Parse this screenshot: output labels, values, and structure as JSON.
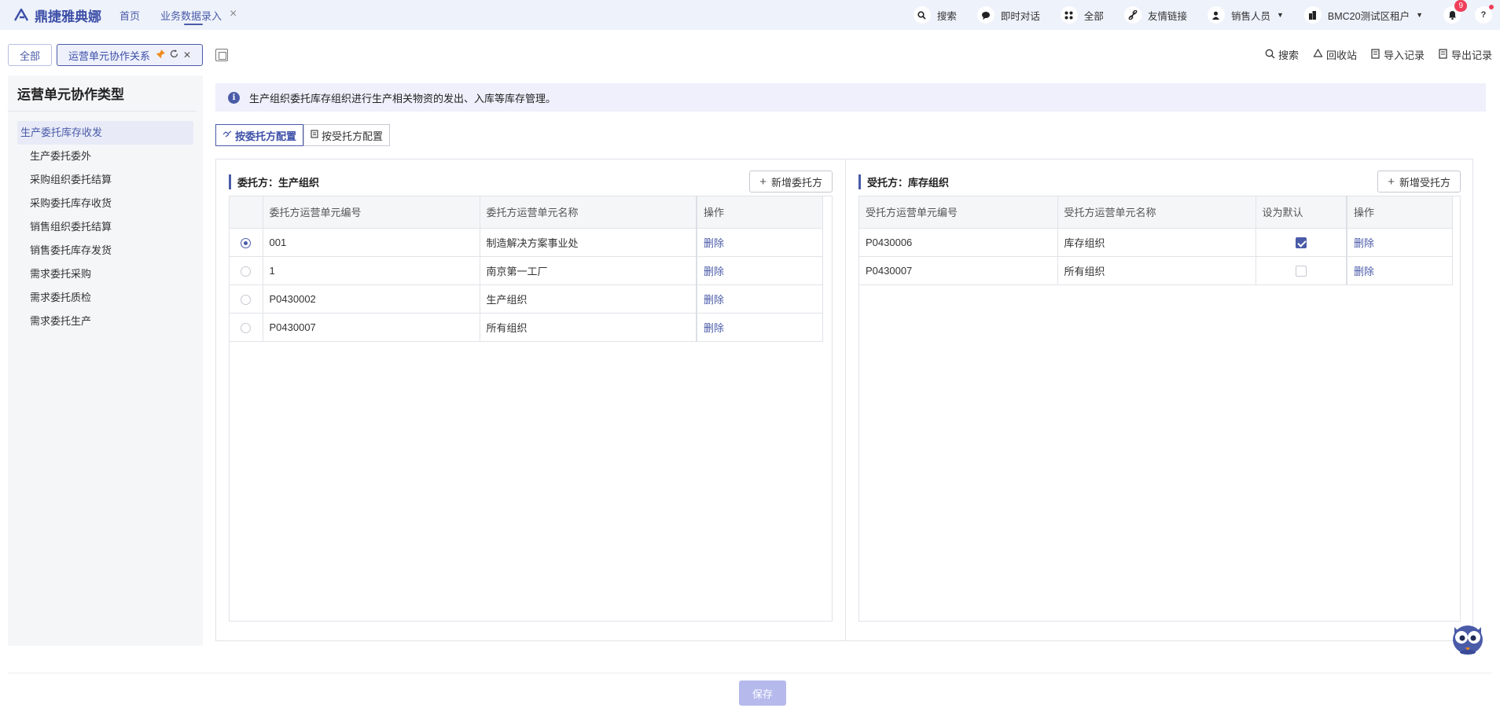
{
  "topbar": {
    "logo_text": "鼎捷雅典娜",
    "nav": [
      {
        "label": "首页"
      },
      {
        "label": "业务数据录入"
      }
    ],
    "close_glyph": "×",
    "right_items": [
      {
        "label": "搜索",
        "icon": "search-icon"
      },
      {
        "label": "即时对话",
        "icon": "chat-icon"
      },
      {
        "label": "全部",
        "icon": "grid-icon"
      },
      {
        "label": "友情链接",
        "icon": "link-icon"
      },
      {
        "label": "销售人员",
        "icon": "user-icon"
      },
      {
        "label": "BMC20测试区租户",
        "icon": "building-icon"
      }
    ],
    "notification_count": "9"
  },
  "tabs": {
    "all_label": "全部",
    "active_label": "运营单元协作关系"
  },
  "right_links": [
    {
      "label": "搜索",
      "icon": "search-icon"
    },
    {
      "label": "回收站",
      "icon": "recycle-icon"
    },
    {
      "label": "导入记录",
      "icon": "import-icon"
    },
    {
      "label": "导出记录",
      "icon": "export-icon"
    }
  ],
  "sidebar": {
    "title": "运营单元协作类型",
    "items": [
      {
        "label": "生产委托库存收发",
        "active": true
      },
      {
        "label": "生产委托委外"
      },
      {
        "label": "采购组织委托结算"
      },
      {
        "label": "采购委托库存收货"
      },
      {
        "label": "销售组织委托结算"
      },
      {
        "label": "销售委托库存发货"
      },
      {
        "label": "需求委托采购"
      },
      {
        "label": "需求委托质检"
      },
      {
        "label": "需求委托生产"
      }
    ]
  },
  "info": {
    "icon_glyph": "i",
    "text": "生产组织委托库存组织进行生产相关物资的发出、入库等库存管理。"
  },
  "toggle": {
    "by_delegator": "按委托方配置",
    "by_delegatee": "按受托方配置"
  },
  "left_panel": {
    "title": "委托方：生产组织",
    "add_label": "新增委托方",
    "columns": [
      "委托方运营单元编号",
      "委托方运营单元名称",
      "操作"
    ],
    "rows": [
      {
        "code": "001",
        "name": "制造解决方案事业处",
        "op": "删除",
        "selected": true
      },
      {
        "code": "1",
        "name": "南京第一工厂",
        "op": "删除"
      },
      {
        "code": "P0430002",
        "name": "生产组织",
        "op": "删除"
      },
      {
        "code": "P0430007",
        "name": "所有组织",
        "op": "删除"
      }
    ]
  },
  "right_panel": {
    "title": "受托方：库存组织",
    "add_label": "新增受托方",
    "columns": [
      "受托方运营单元编号",
      "受托方运营单元名称",
      "设为默认",
      "操作"
    ],
    "rows": [
      {
        "code": "P0430006",
        "name": "库存组织",
        "default": true,
        "op": "删除"
      },
      {
        "code": "P0430007",
        "name": "所有组织",
        "default": false,
        "op": "删除"
      }
    ]
  },
  "footer": {
    "save_label": "保存"
  },
  "colors": {
    "accent": "#4a5ba8",
    "badge": "#ef3e5a",
    "save_disabled": "#b5b9ec"
  }
}
